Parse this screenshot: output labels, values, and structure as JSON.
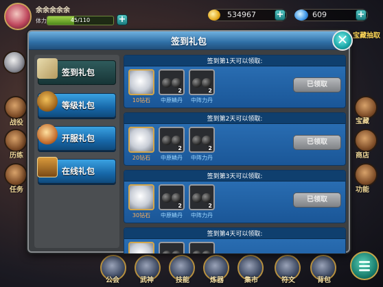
{
  "hud": {
    "player_name": "余余余余余",
    "hp_label": "体力",
    "hp_text": "45/110",
    "hp_fraction": 0.41,
    "coins": "534967",
    "gems": "609",
    "right_banner": "宝藏抽取"
  },
  "side_left": [
    {
      "label": "战役"
    },
    {
      "label": "历练"
    },
    {
      "label": "任务"
    }
  ],
  "side_right": [
    {
      "label": "宝藏"
    },
    {
      "label": "商店"
    },
    {
      "label": "功能"
    }
  ],
  "bottom_nav": [
    {
      "label": "公会"
    },
    {
      "label": "武神"
    },
    {
      "label": "技能"
    },
    {
      "label": "炼器"
    },
    {
      "label": "集市"
    },
    {
      "label": "符文"
    },
    {
      "label": "背包"
    }
  ],
  "dialog": {
    "title": "签到礼包",
    "close_label": "✕"
  },
  "tabs": [
    {
      "label": "签到礼包",
      "active": true
    },
    {
      "label": "等级礼包",
      "active": false
    },
    {
      "label": "开服礼包",
      "active": false
    },
    {
      "label": "在线礼包",
      "active": false
    }
  ],
  "rewards": [
    {
      "header": "签到第1天可以领取:",
      "items": [
        {
          "name": "10钻石",
          "count": ""
        },
        {
          "name": "中原鳞丹",
          "count": "2"
        },
        {
          "name": "中阵力丹",
          "count": "2"
        }
      ],
      "button": "已领取"
    },
    {
      "header": "签到第2天可以领取:",
      "items": [
        {
          "name": "20钻石",
          "count": ""
        },
        {
          "name": "中原鳞丹",
          "count": "2"
        },
        {
          "name": "中阵力丹",
          "count": "2"
        }
      ],
      "button": "已领取"
    },
    {
      "header": "签到第3天可以领取:",
      "items": [
        {
          "name": "30钻石",
          "count": ""
        },
        {
          "name": "中原鳞丹",
          "count": "2"
        },
        {
          "name": "中阵力丹",
          "count": "2"
        }
      ],
      "button": "已领取"
    },
    {
      "header": "签到第4天可以领取:",
      "items": [
        {
          "name": "",
          "count": ""
        },
        {
          "name": "",
          "count": ""
        },
        {
          "name": "",
          "count": ""
        }
      ],
      "button": ""
    }
  ],
  "colors": {
    "dialog_bg": "#3c3f42",
    "title_bar": "#2f6fa6",
    "card_bg": "#1a5697",
    "caption_orange": "#ffb15b",
    "caption_blue": "#9fd8ff"
  }
}
